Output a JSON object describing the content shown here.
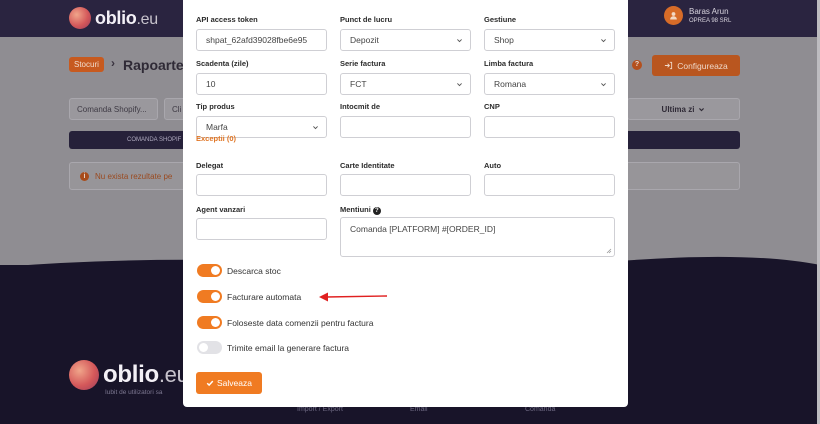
{
  "header": {
    "logo_text": "oblio",
    "logo_suffix": ".eu",
    "user_name": "Baras Arun",
    "user_company": "OPREA 98 SRL"
  },
  "page": {
    "breadcrumb_tag": "Stocuri",
    "breadcrumb_title": "Rapoarte",
    "configure_label": "Configureaza",
    "filter_shop": "Comanda Shopify...",
    "filter_second": "Cli",
    "period_label": "Ultima zi",
    "table_column": "COMANDA SHOPIF",
    "empty_message": "Nu exista rezultate pe"
  },
  "footer": {
    "logo_text": "oblio",
    "logo_suffix": ".eu",
    "tagline": "Iubit de utilizatori sa",
    "links": [
      "Import / Export",
      "Email",
      "Comanda"
    ]
  },
  "modal": {
    "rows": [
      {
        "fields": [
          {
            "label": "API access token",
            "value": "shpat_62afd39028fbe6e95",
            "type": "input"
          },
          {
            "label": "Punct de lucru",
            "value": "Depozit",
            "type": "select"
          },
          {
            "label": "Gestiune",
            "value": "Shop",
            "type": "select"
          }
        ]
      },
      {
        "fields": [
          {
            "label": "Scadenta (zile)",
            "value": "10",
            "type": "input"
          },
          {
            "label": "Serie factura",
            "value": "FCT",
            "type": "select"
          },
          {
            "label": "Limba factura",
            "value": "Romana",
            "type": "select"
          }
        ]
      },
      {
        "fields": [
          {
            "label": "Tip produs",
            "value": "Marfa",
            "type": "select"
          },
          {
            "label": "Intocmit de",
            "value": "",
            "type": "input"
          },
          {
            "label": "CNP",
            "value": "",
            "type": "input"
          }
        ]
      },
      {
        "fields": [
          {
            "label": "Delegat",
            "value": "",
            "type": "input"
          },
          {
            "label": "Carte Identitate",
            "value": "",
            "type": "input"
          },
          {
            "label": "Auto",
            "value": "",
            "type": "input"
          }
        ]
      }
    ],
    "exceptii_link": "Exceptii (0)",
    "agent_label": "Agent vanzari",
    "agent_value": "",
    "mentiuni_label": "Mentiuni",
    "mentiuni_value": "Comanda [PLATFORM] #[ORDER_ID]",
    "toggles": [
      {
        "label": "Descarca stoc",
        "on": true
      },
      {
        "label": "Facturare automata",
        "on": true
      },
      {
        "label": "Foloseste data comenzii pentru factura",
        "on": true
      },
      {
        "label": "Trimite email la generare factura",
        "on": false
      }
    ],
    "save_label": "Salveaza"
  },
  "colors": {
    "accent": "#f07b22",
    "annotation_arrow": "#e02020",
    "dark_header": "#2a2440"
  }
}
